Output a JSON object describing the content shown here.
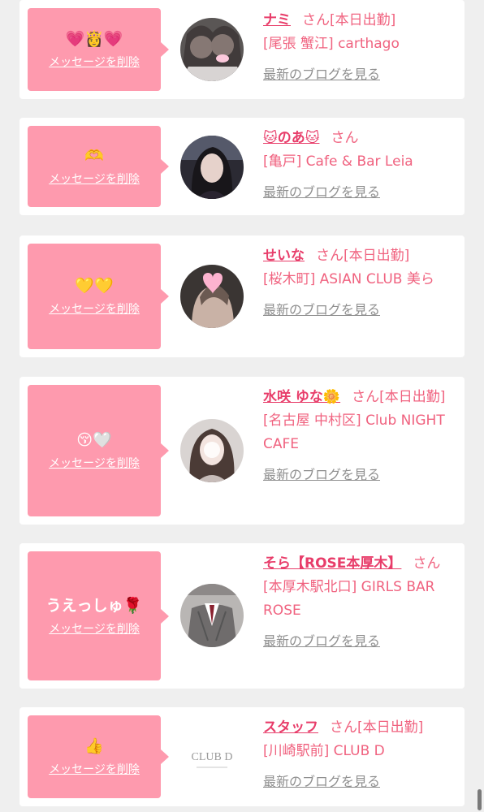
{
  "delete_label": "メッセージを削除",
  "blog_label": "最新のブログを見る",
  "san_label": "さん",
  "accent_color": "#fe9aae",
  "name_color": "#e83d6a",
  "cards": [
    {
      "message": "💗👸💗",
      "name": "ナミ",
      "status": "[本日出勤]",
      "shop": "[尾張 蟹江] carthago"
    },
    {
      "message": "🫶",
      "name": "🐱のあ🐱",
      "status": "",
      "shop": "[亀戸] Cafe & Bar Leia"
    },
    {
      "message": "💛💛",
      "name": "せいな",
      "status": "[本日出勤]",
      "shop": "[桜木町] ASIAN CLUB 美ら"
    },
    {
      "message": "😚🤍",
      "name": "水咲 ゆな🌼",
      "status": "[本日出勤]",
      "shop": "[名古屋 中村区] Club NIGHT CAFE"
    },
    {
      "message": "うえっしゅ🌹",
      "name": "そら【ROSE本厚木】",
      "status": "",
      "shop": "[本厚木駅北口] GIRLS BAR ROSE"
    },
    {
      "message": "👍",
      "name": "スタッフ",
      "status": "[本日出勤]",
      "shop": "[川崎駅前] CLUB D",
      "logo_text": "CLUB D"
    }
  ]
}
